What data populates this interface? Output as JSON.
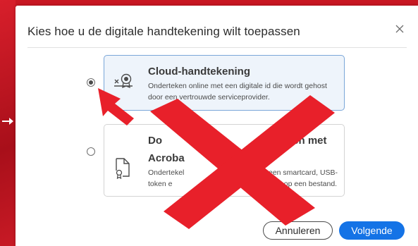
{
  "dialog": {
    "title": "Kies hoe u de digitale handtekening wilt toepassen",
    "close_icon": "close-icon"
  },
  "options": [
    {
      "title": "Cloud-handtekening",
      "description_line1": "Onderteken online met een digitale id die wordt gehost",
      "description_line2": "door een vertrouwde serviceprovider.",
      "icon": "cloud-signature-icon",
      "selected": true
    },
    {
      "title_line1": "Do",
      "title_line1_right": "nen met",
      "title_line2": "Acroba",
      "description_line1_left": "Ondertekel",
      "description_line1_right": "een smartcard, USB-",
      "description_line2_left": "token e",
      "description_line2_right": "d op een bestand.",
      "icon": "document-certificate-icon",
      "selected": false
    }
  ],
  "buttons": {
    "cancel_label": "Annuleren",
    "next_label": "Volgende"
  },
  "annotations": {
    "pointer_arrow": "red-arrow-icon",
    "cross_mark": "red-x-icon",
    "annotation_color": "#e8202a"
  },
  "colors": {
    "accent": "#1473e6",
    "selected_border": "#7aa6d8",
    "selected_bg": "#eef4fb",
    "background_red": "#b8121e"
  }
}
